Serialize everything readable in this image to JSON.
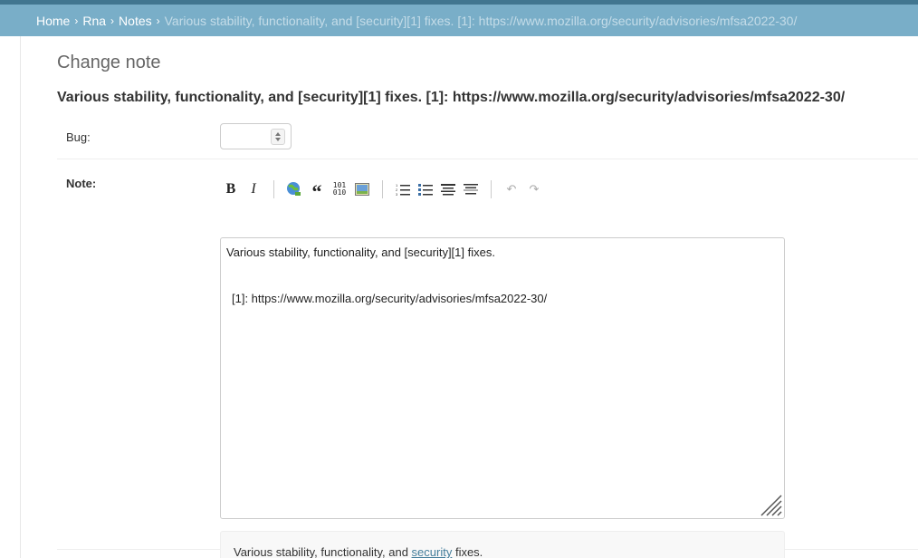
{
  "breadcrumbs": {
    "home": "Home",
    "app": "Rna",
    "model": "Notes",
    "current": "Various stability, functionality, and [security][1] fixes. [1]: https://www.mozilla.org/security/advisories/mfsa2022-30/",
    "separator": "›"
  },
  "page": {
    "title": "Change note",
    "object_title": "Various stability, functionality, and [security][1] fixes. [1]: https://www.mozilla.org/security/advisories/mfsa2022-30/"
  },
  "form": {
    "bug": {
      "label": "Bug:",
      "value": ""
    },
    "note": {
      "label": "Note:",
      "line1": "Various stability, functionality, and [security][1] fixes.",
      "line2": "[1]: https://www.mozilla.org/security/advisories/mfsa2022-30/"
    }
  },
  "toolbar": {
    "bold": "B",
    "italic": "I",
    "quote": "“",
    "code": "101\n010",
    "icons": [
      "bold-icon",
      "italic-icon",
      "link-icon",
      "quote-icon",
      "code-icon",
      "image-icon",
      "ordered-list-icon",
      "unordered-list-icon",
      "heading-icon",
      "horizontal-rule-icon",
      "undo-icon",
      "redo-icon"
    ]
  },
  "preview": {
    "before": "Various stability, functionality, and ",
    "link": "security",
    "after": " fixes."
  },
  "colors": {
    "header": "#417690",
    "breadcrumb_bg": "#79aec8",
    "link": "#447e9b"
  }
}
